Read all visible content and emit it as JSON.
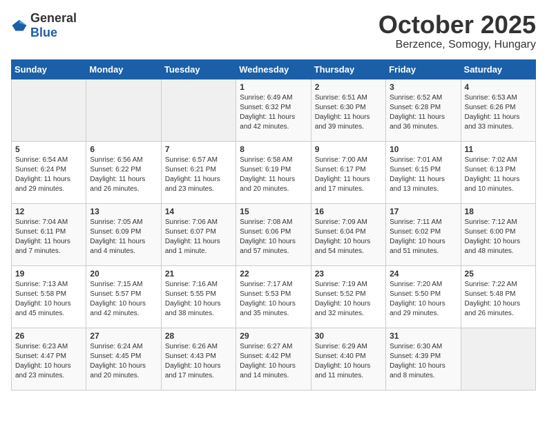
{
  "logo": {
    "general": "General",
    "blue": "Blue"
  },
  "title": "October 2025",
  "subtitle": "Berzence, Somogy, Hungary",
  "days_of_week": [
    "Sunday",
    "Monday",
    "Tuesday",
    "Wednesday",
    "Thursday",
    "Friday",
    "Saturday"
  ],
  "weeks": [
    [
      {
        "day": "",
        "info": ""
      },
      {
        "day": "",
        "info": ""
      },
      {
        "day": "",
        "info": ""
      },
      {
        "day": "1",
        "info": "Sunrise: 6:49 AM\nSunset: 6:32 PM\nDaylight: 11 hours and 42 minutes."
      },
      {
        "day": "2",
        "info": "Sunrise: 6:51 AM\nSunset: 6:30 PM\nDaylight: 11 hours and 39 minutes."
      },
      {
        "day": "3",
        "info": "Sunrise: 6:52 AM\nSunset: 6:28 PM\nDaylight: 11 hours and 36 minutes."
      },
      {
        "day": "4",
        "info": "Sunrise: 6:53 AM\nSunset: 6:26 PM\nDaylight: 11 hours and 33 minutes."
      }
    ],
    [
      {
        "day": "5",
        "info": "Sunrise: 6:54 AM\nSunset: 6:24 PM\nDaylight: 11 hours and 29 minutes."
      },
      {
        "day": "6",
        "info": "Sunrise: 6:56 AM\nSunset: 6:22 PM\nDaylight: 11 hours and 26 minutes."
      },
      {
        "day": "7",
        "info": "Sunrise: 6:57 AM\nSunset: 6:21 PM\nDaylight: 11 hours and 23 minutes."
      },
      {
        "day": "8",
        "info": "Sunrise: 6:58 AM\nSunset: 6:19 PM\nDaylight: 11 hours and 20 minutes."
      },
      {
        "day": "9",
        "info": "Sunrise: 7:00 AM\nSunset: 6:17 PM\nDaylight: 11 hours and 17 minutes."
      },
      {
        "day": "10",
        "info": "Sunrise: 7:01 AM\nSunset: 6:15 PM\nDaylight: 11 hours and 13 minutes."
      },
      {
        "day": "11",
        "info": "Sunrise: 7:02 AM\nSunset: 6:13 PM\nDaylight: 11 hours and 10 minutes."
      }
    ],
    [
      {
        "day": "12",
        "info": "Sunrise: 7:04 AM\nSunset: 6:11 PM\nDaylight: 11 hours and 7 minutes."
      },
      {
        "day": "13",
        "info": "Sunrise: 7:05 AM\nSunset: 6:09 PM\nDaylight: 11 hours and 4 minutes."
      },
      {
        "day": "14",
        "info": "Sunrise: 7:06 AM\nSunset: 6:07 PM\nDaylight: 11 hours and 1 minute."
      },
      {
        "day": "15",
        "info": "Sunrise: 7:08 AM\nSunset: 6:06 PM\nDaylight: 10 hours and 57 minutes."
      },
      {
        "day": "16",
        "info": "Sunrise: 7:09 AM\nSunset: 6:04 PM\nDaylight: 10 hours and 54 minutes."
      },
      {
        "day": "17",
        "info": "Sunrise: 7:11 AM\nSunset: 6:02 PM\nDaylight: 10 hours and 51 minutes."
      },
      {
        "day": "18",
        "info": "Sunrise: 7:12 AM\nSunset: 6:00 PM\nDaylight: 10 hours and 48 minutes."
      }
    ],
    [
      {
        "day": "19",
        "info": "Sunrise: 7:13 AM\nSunset: 5:58 PM\nDaylight: 10 hours and 45 minutes."
      },
      {
        "day": "20",
        "info": "Sunrise: 7:15 AM\nSunset: 5:57 PM\nDaylight: 10 hours and 42 minutes."
      },
      {
        "day": "21",
        "info": "Sunrise: 7:16 AM\nSunset: 5:55 PM\nDaylight: 10 hours and 38 minutes."
      },
      {
        "day": "22",
        "info": "Sunrise: 7:17 AM\nSunset: 5:53 PM\nDaylight: 10 hours and 35 minutes."
      },
      {
        "day": "23",
        "info": "Sunrise: 7:19 AM\nSunset: 5:52 PM\nDaylight: 10 hours and 32 minutes."
      },
      {
        "day": "24",
        "info": "Sunrise: 7:20 AM\nSunset: 5:50 PM\nDaylight: 10 hours and 29 minutes."
      },
      {
        "day": "25",
        "info": "Sunrise: 7:22 AM\nSunset: 5:48 PM\nDaylight: 10 hours and 26 minutes."
      }
    ],
    [
      {
        "day": "26",
        "info": "Sunrise: 6:23 AM\nSunset: 4:47 PM\nDaylight: 10 hours and 23 minutes."
      },
      {
        "day": "27",
        "info": "Sunrise: 6:24 AM\nSunset: 4:45 PM\nDaylight: 10 hours and 20 minutes."
      },
      {
        "day": "28",
        "info": "Sunrise: 6:26 AM\nSunset: 4:43 PM\nDaylight: 10 hours and 17 minutes."
      },
      {
        "day": "29",
        "info": "Sunrise: 6:27 AM\nSunset: 4:42 PM\nDaylight: 10 hours and 14 minutes."
      },
      {
        "day": "30",
        "info": "Sunrise: 6:29 AM\nSunset: 4:40 PM\nDaylight: 10 hours and 11 minutes."
      },
      {
        "day": "31",
        "info": "Sunrise: 6:30 AM\nSunset: 4:39 PM\nDaylight: 10 hours and 8 minutes."
      },
      {
        "day": "",
        "info": ""
      }
    ]
  ]
}
